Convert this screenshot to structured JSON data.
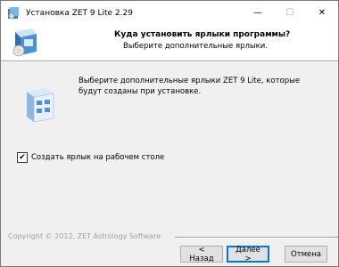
{
  "window": {
    "title": "Установка ZET 9 Lite 2.29",
    "controls": {
      "minimize": "—",
      "maximize": "☐",
      "close": "✕"
    }
  },
  "header": {
    "title": "Куда установить ярлыки программы?",
    "subtitle": "Выберите дополнительные ярлыки."
  },
  "body": {
    "description": "Выберите дополнительные ярлыки ZET 9 Lite, которые будут созданы при установке.",
    "checkbox": {
      "label": "Создать ярлык на рабочем столе",
      "checked": true,
      "mark": "✔"
    }
  },
  "footer": {
    "copyright": "Copyright © 2012, ZET Astrology Software",
    "buttons": {
      "back": "< Назад",
      "next": "Далее >",
      "cancel": "Отмена"
    }
  },
  "colors": {
    "accent": "#0078d7",
    "banner_bg": "#ffffff",
    "window_bg": "#f0f0f0"
  },
  "icons": [
    "installer-app-icon",
    "installer-box-logo",
    "shortcuts-folder-icon"
  ]
}
